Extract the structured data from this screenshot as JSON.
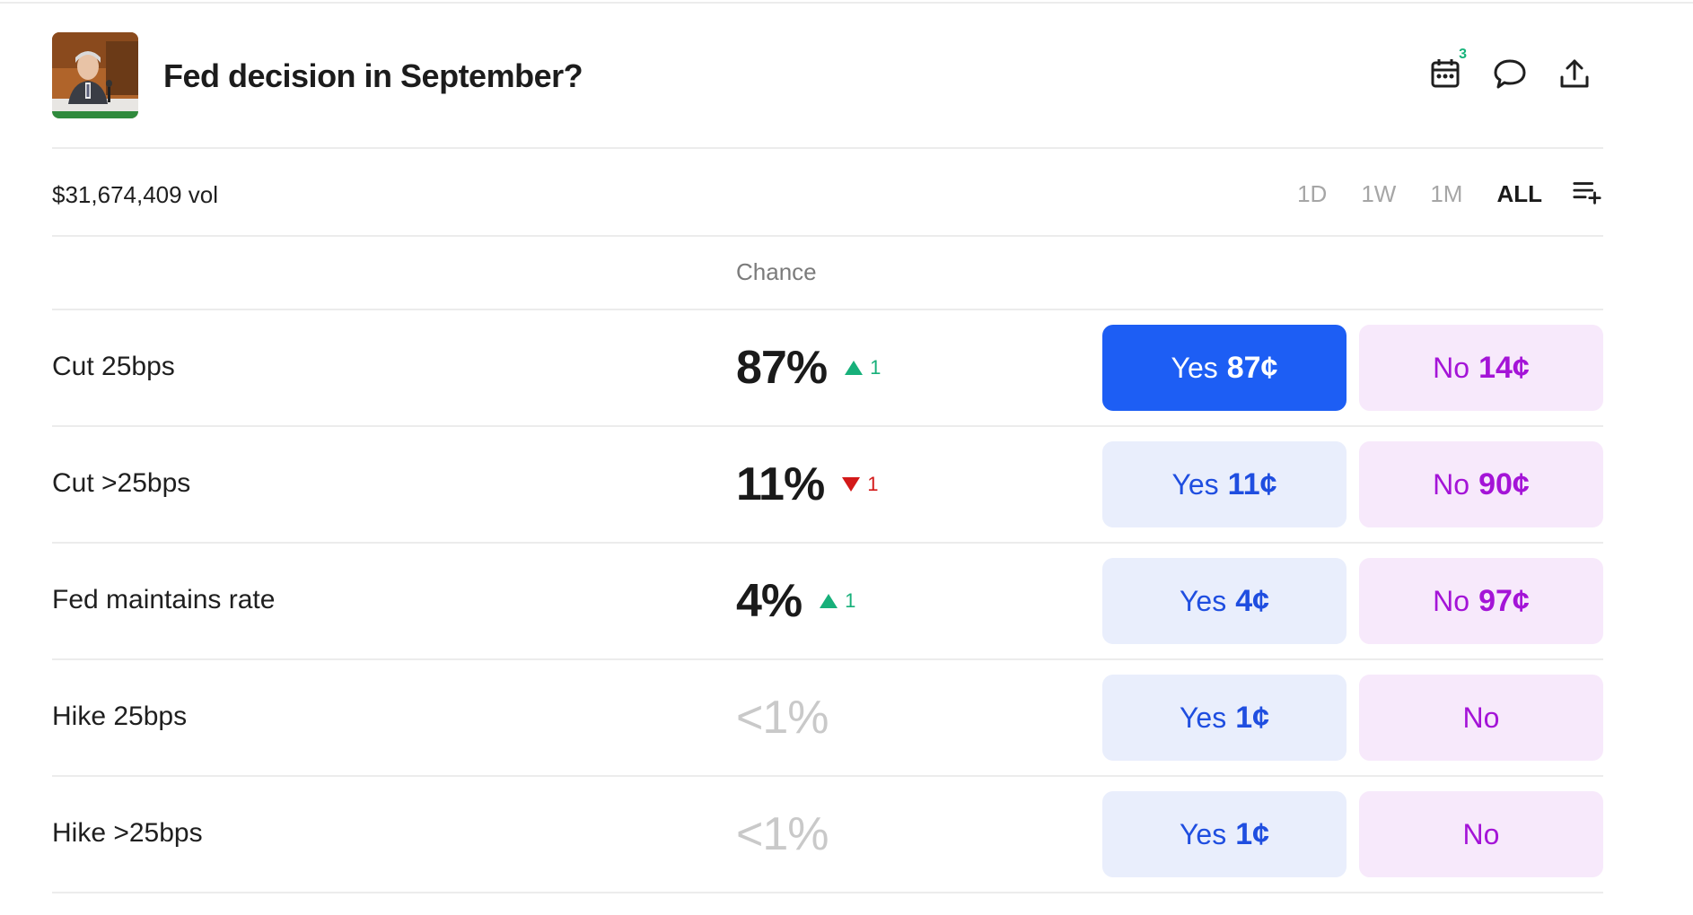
{
  "market": {
    "title": "Fed decision in September?",
    "calendar_badge": "3",
    "volume": "$31,674,409 vol"
  },
  "range": {
    "options": [
      "1D",
      "1W",
      "1M",
      "ALL"
    ],
    "selected": "ALL"
  },
  "table": {
    "chance_header": "Chance",
    "rows": [
      {
        "label": "Cut 25bps",
        "chance": "87%",
        "delta": "1",
        "direction": "up",
        "yes_word": "Yes",
        "yes_price": "87¢",
        "no_word": "No",
        "no_price": "14¢",
        "yes_selected": true,
        "muted": false
      },
      {
        "label": "Cut >25bps",
        "chance": "11%",
        "delta": "1",
        "direction": "down",
        "yes_word": "Yes",
        "yes_price": "11¢",
        "no_word": "No",
        "no_price": "90¢",
        "yes_selected": false,
        "muted": false
      },
      {
        "label": "Fed maintains rate",
        "chance": "4%",
        "delta": "1",
        "direction": "up",
        "yes_word": "Yes",
        "yes_price": "4¢",
        "no_word": "No",
        "no_price": "97¢",
        "yes_selected": false,
        "muted": false
      },
      {
        "label": "Hike 25bps",
        "chance": "<1%",
        "delta": "",
        "direction": "",
        "yes_word": "Yes",
        "yes_price": "1¢",
        "no_word": "No",
        "no_price": "",
        "yes_selected": false,
        "muted": true
      },
      {
        "label": "Hike >25bps",
        "chance": "<1%",
        "delta": "",
        "direction": "",
        "yes_word": "Yes",
        "yes_price": "1¢",
        "no_word": "No",
        "no_price": "",
        "yes_selected": false,
        "muted": true
      }
    ]
  },
  "colors": {
    "yes_selected_bg": "#1d5ef4",
    "yes_bg": "#e9eefc",
    "yes_text": "#1f4ee0",
    "no_bg": "#f7e9fb",
    "no_text": "#a414d7",
    "up": "#17b07a",
    "down": "#d31919"
  },
  "icons": {
    "calendar": "calendar-icon",
    "comment": "comment-icon",
    "share": "share-icon",
    "list_add": "list-add-icon"
  }
}
